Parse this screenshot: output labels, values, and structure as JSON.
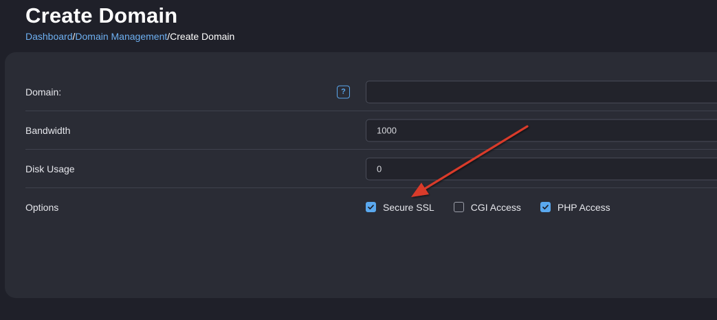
{
  "header": {
    "title": "Create Domain"
  },
  "breadcrumb": {
    "items": [
      {
        "label": "Dashboard"
      },
      {
        "label": "Domain Management"
      },
      {
        "label": "Create Domain"
      }
    ],
    "separator": "/"
  },
  "form": {
    "domain": {
      "label": "Domain:",
      "value": "",
      "help_icon": "question-icon"
    },
    "bandwidth": {
      "label": "Bandwidth",
      "value": "1000"
    },
    "disk_usage": {
      "label": "Disk Usage",
      "value": "0"
    },
    "options": {
      "label": "Options",
      "items": [
        {
          "label": "Secure SSL",
          "checked": true
        },
        {
          "label": "CGI Access",
          "checked": false
        },
        {
          "label": "PHP Access",
          "checked": true
        }
      ]
    }
  },
  "annotation": {
    "arrow_color": "#d93a2b"
  },
  "colors": {
    "accent": "#5aa8ee",
    "link": "#6eb0f2",
    "background": "#1f2029",
    "panel": "#2a2c35"
  }
}
